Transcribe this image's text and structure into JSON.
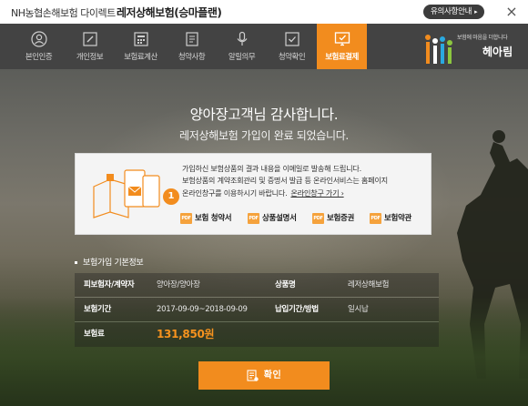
{
  "titlebar": {
    "brand": "NH농협손해보험 다이렉트",
    "product": "레저상해보험(승마플랜)",
    "notice": "유의사항안내",
    "notice_chevron": "▸",
    "close": "×"
  },
  "nav": {
    "items": [
      {
        "label": "본인인증",
        "icon": "person-icon"
      },
      {
        "label": "개인정보",
        "icon": "edit-icon"
      },
      {
        "label": "보험료계산",
        "icon": "calculator-icon"
      },
      {
        "label": "청약사항",
        "icon": "document-icon"
      },
      {
        "label": "알릴의무",
        "icon": "microphone-icon"
      },
      {
        "label": "청약확인",
        "icon": "checkbox-icon"
      },
      {
        "label": "보험료결제",
        "icon": "payment-icon"
      }
    ],
    "active_index": 6,
    "logo_slogan": "보험에 마음을 더합니다",
    "logo_text": "헤아림"
  },
  "hero": {
    "thanks": "양아장고객님 감사합니다.",
    "subtext": "레저상해보험 가입이 완료 되었습니다."
  },
  "card": {
    "step_number": "1",
    "lines": [
      "가입하신 보험상품의 결과 내용을 이메일로 발송해 드립니다.",
      "보험상품의 계약조회관리 및 증명서 발급 등 온라인서비스는 홈페이지",
      "온라인창구를 이용하시기 바랍니다."
    ],
    "link": "온라인창구 가기 ›",
    "pdf_badge": "PDF",
    "docs": [
      "보험 청약서",
      "상품설명서",
      "보험증권",
      "보험약관"
    ]
  },
  "info": {
    "section_title": "보험가입 기본정보",
    "rows": [
      {
        "h1": "피보험자/계약자",
        "v1": "양아장/양아장",
        "h2": "상품명",
        "v2": "레저상해보험"
      },
      {
        "h1": "보험기간",
        "v1": "2017-09-09~2018-09-09",
        "h2": "납입기간/방법",
        "v2": "일시납"
      },
      {
        "h1": "보험료",
        "v1": "131,850원"
      }
    ]
  },
  "confirm_label": "확인",
  "colors": {
    "accent": "#f28c1e",
    "nav_bg": "#434343",
    "price": "#f7931e"
  }
}
